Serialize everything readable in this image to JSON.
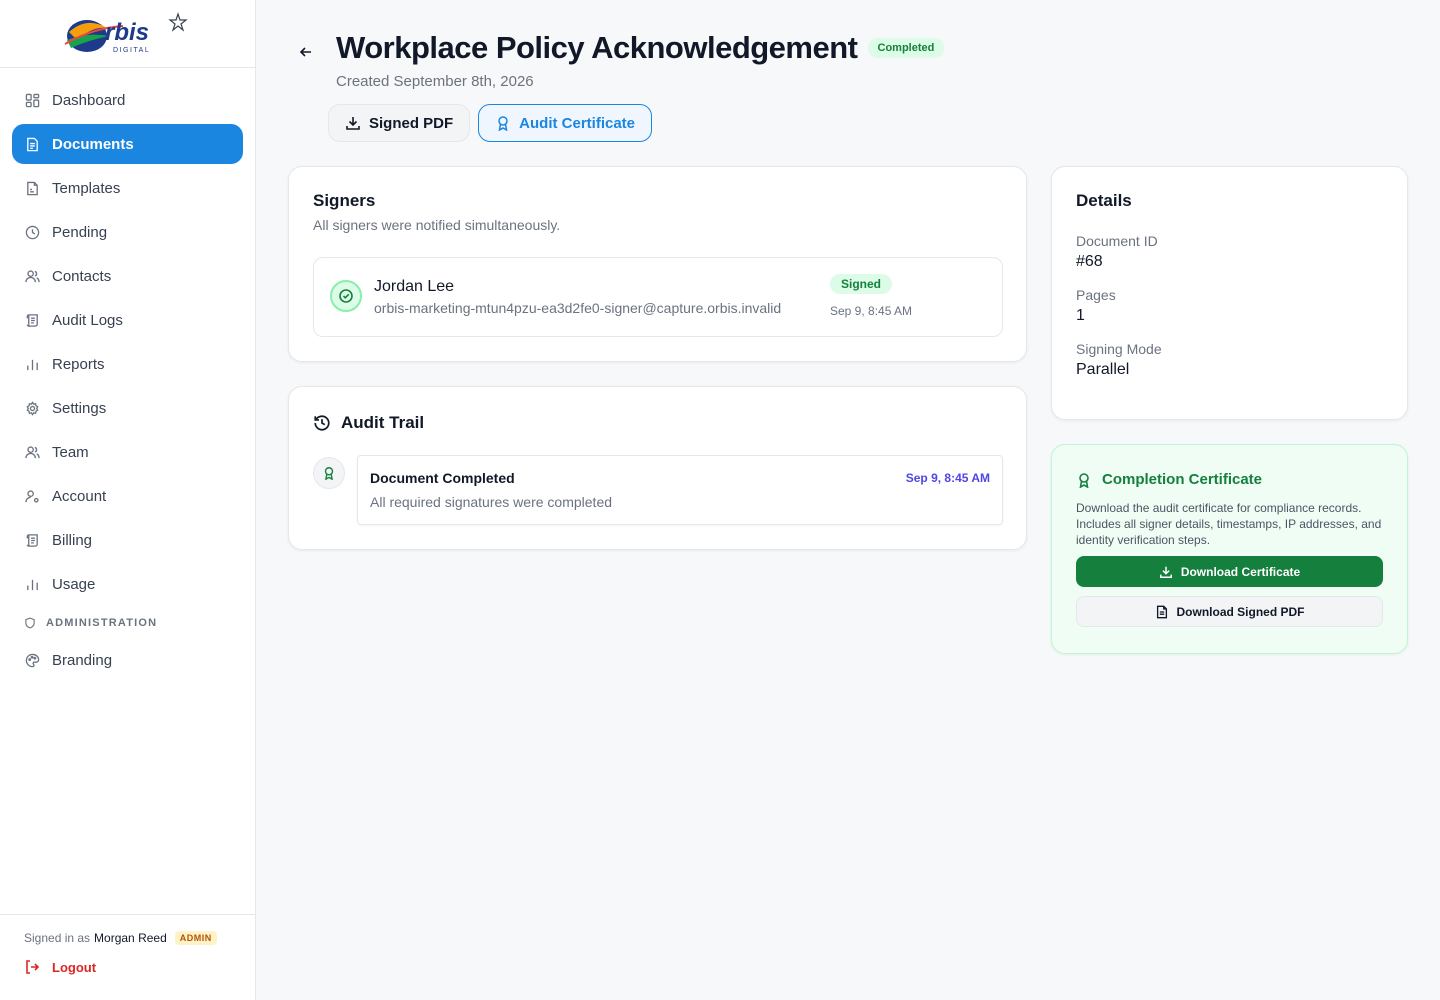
{
  "brand": {
    "logo_text": "rbis",
    "logo_sub": "DIGITAL"
  },
  "sidebar": {
    "items": [
      {
        "label": "Dashboard",
        "icon": "dashboard-icon"
      },
      {
        "label": "Documents",
        "icon": "document-icon",
        "active": true
      },
      {
        "label": "Templates",
        "icon": "template-icon"
      },
      {
        "label": "Pending",
        "icon": "clock-icon"
      },
      {
        "label": "Contacts",
        "icon": "users-icon"
      },
      {
        "label": "Audit Logs",
        "icon": "scroll-icon"
      },
      {
        "label": "Reports",
        "icon": "bar-chart-icon"
      },
      {
        "label": "Settings",
        "icon": "gear-icon"
      },
      {
        "label": "Team",
        "icon": "team-icon"
      },
      {
        "label": "Account",
        "icon": "user-cog-icon"
      },
      {
        "label": "Billing",
        "icon": "receipt-icon"
      },
      {
        "label": "Usage",
        "icon": "bar-chart-icon"
      }
    ],
    "section_label": "ADMINISTRATION",
    "admin_items": [
      {
        "label": "Branding",
        "icon": "palette-icon"
      }
    ],
    "footer": {
      "signed_in_prefix": "Signed in as",
      "user_name": "Morgan Reed",
      "role_badge": "ADMIN",
      "logout_label": "Logout"
    }
  },
  "header": {
    "title": "Workplace Policy Acknowledgement",
    "status": "Completed",
    "created": "Created September 8th, 2026",
    "buttons": {
      "signed_pdf": "Signed PDF",
      "audit_certificate": "Audit Certificate"
    }
  },
  "signers": {
    "title": "Signers",
    "subtitle": "All signers were notified simultaneously.",
    "list": [
      {
        "name": "Jordan Lee",
        "email": "orbis-marketing-mtun4pzu-ea3d2fe0-signer@capture.orbis.invalid",
        "status": "Signed",
        "time": "Sep 9, 8:45 AM"
      }
    ]
  },
  "audit": {
    "title": "Audit Trail",
    "events": [
      {
        "title": "Document Completed",
        "description": "All required signatures were completed",
        "time": "Sep 9, 8:45 AM"
      }
    ]
  },
  "details": {
    "title": "Details",
    "document_id_label": "Document ID",
    "document_id": "#68",
    "pages_label": "Pages",
    "pages": "1",
    "signing_mode_label": "Signing Mode",
    "signing_mode": "Parallel"
  },
  "certificate": {
    "title": "Completion Certificate",
    "description": "Download the audit certificate for compliance records. Includes all signer details, timestamps, IP addresses, and identity verification steps.",
    "download_certificate": "Download Certificate",
    "download_signed_pdf": "Download Signed PDF"
  },
  "colors": {
    "primary": "#1a86e0",
    "success": "#15803d",
    "success_bg": "#dcfce7",
    "danger": "#dc2626"
  }
}
